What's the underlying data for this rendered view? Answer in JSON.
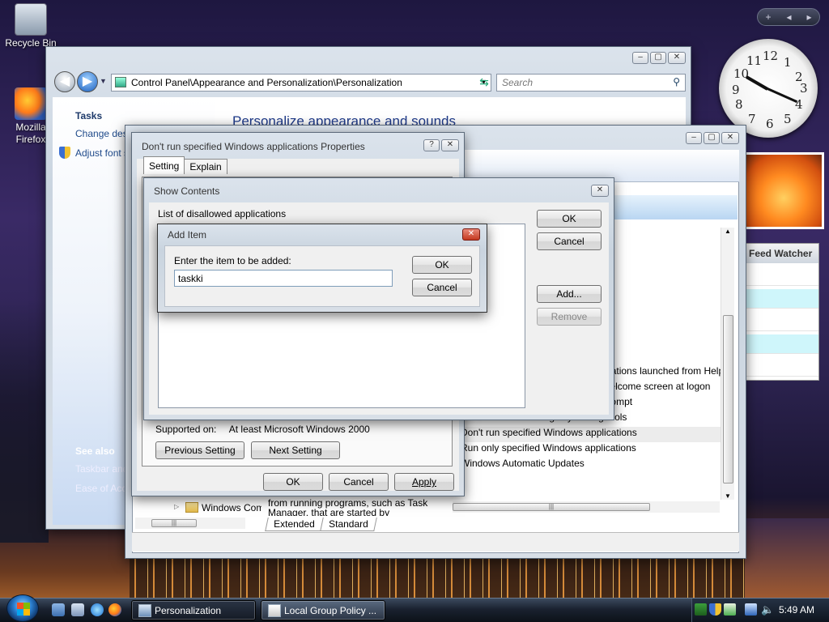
{
  "desktop": {
    "icons": [
      {
        "label": "Recycle Bin",
        "icon": "recycle-bin-icon"
      },
      {
        "label": "Mozilla Firefox",
        "icon": "firefox-icon"
      }
    ]
  },
  "sidebar_gadgets": {
    "controls": {
      "add": "+",
      "prev": "◂",
      "next": "▸"
    },
    "clock": {
      "numbers": [
        "12",
        "1",
        "2",
        "3",
        "4",
        "5",
        "6",
        "7",
        "8",
        "9",
        "10",
        "11"
      ]
    },
    "feed_watcher": {
      "title": "Feed Watcher"
    }
  },
  "control_panel": {
    "address": "Control Panel\\Appearance and Personalization\\Personalization",
    "search_placeholder": "Search",
    "tasks_heading": "Tasks",
    "tasks": [
      "Change desktop icons",
      "Adjust font size (DPI)"
    ],
    "see_also_heading": "See also",
    "see_also": [
      "Taskbar and Start Menu",
      "Ease of Access"
    ],
    "main_heading": "Personalize appearance and sounds"
  },
  "group_policy": {
    "title": "Local Group Policy Editor",
    "settings_list": [
      "Don't run specified Windows applications launched from Help",
      "Don't display the Getting Started welcome screen at logon",
      "Prevent access to the command prompt",
      "Prevent access to registry editing tools",
      "Don't run specified Windows applications",
      "Run only specified Windows applications",
      "Windows Automatic Updates"
    ],
    "selected_index": 4,
    "tree_item": "Windows Components",
    "desc_text": "from running programs, such as Task Manager, that are started by",
    "tabs": [
      "Extended",
      "Standard"
    ]
  },
  "properties_dialog": {
    "title": "Don't run specified Windows applications Properties",
    "tabs": [
      "Setting",
      "Explain"
    ],
    "supported_label": "Supported on:",
    "supported_value": "At least Microsoft Windows 2000",
    "prev_setting": "Previous Setting",
    "next_setting": "Next Setting",
    "ok": "OK",
    "cancel": "Cancel",
    "apply": "Apply"
  },
  "show_contents": {
    "title": "Show Contents",
    "list_label": "List of disallowed applications",
    "ok": "OK",
    "cancel": "Cancel",
    "add": "Add...",
    "remove": "Remove"
  },
  "add_item": {
    "title": "Add Item",
    "prompt": "Enter the item to be added:",
    "value": "taskki",
    "ok": "OK",
    "cancel": "Cancel"
  },
  "taskbar": {
    "buttons": [
      {
        "label": "Personalization",
        "active": true
      },
      {
        "label": "Local Group Policy ...",
        "active": false
      }
    ],
    "time": "5:49 AM"
  }
}
